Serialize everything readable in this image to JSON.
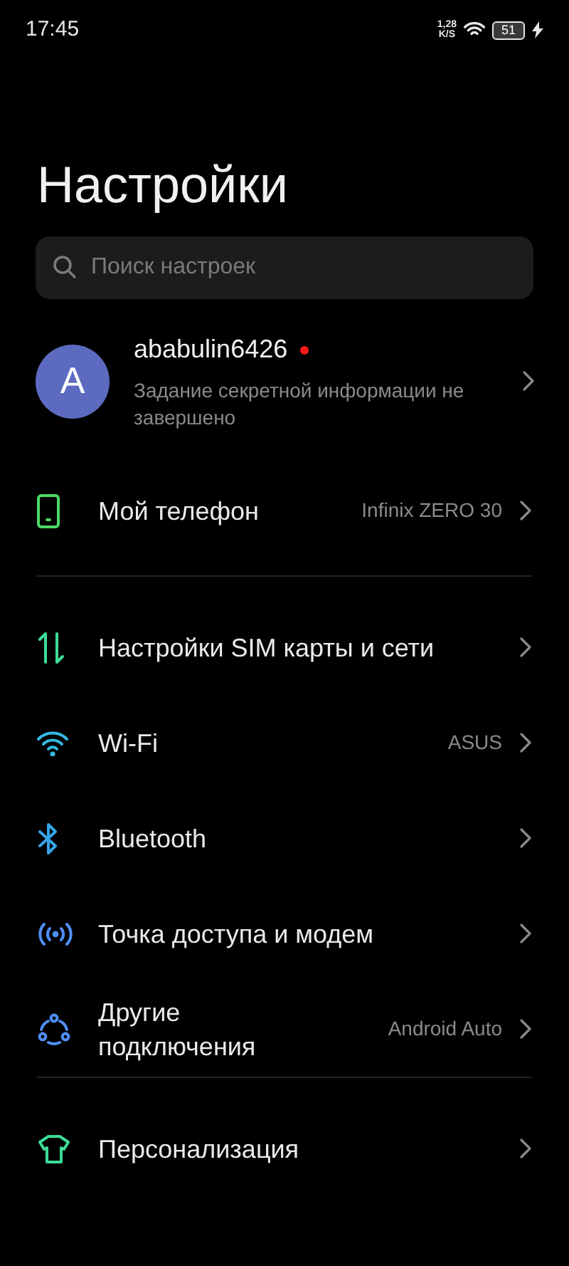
{
  "status_bar": {
    "time": "17:45",
    "speed_value": "1,28",
    "speed_unit": "K/S",
    "battery": "51",
    "charging": true
  },
  "title": "Настройки",
  "search": {
    "placeholder": "Поиск настроек"
  },
  "account": {
    "avatar_letter": "A",
    "name": "ababulin6426",
    "alert": true,
    "subtitle": "Задание секретной информации не завершено"
  },
  "sections": [
    [
      {
        "kind": "phone",
        "label": "Мой телефон",
        "value": "Infinix ZERO 30"
      }
    ],
    [
      {
        "kind": "sim",
        "label": "Настройки SIM карты и сети"
      },
      {
        "kind": "wifi",
        "label": "Wi-Fi",
        "value": "ASUS"
      },
      {
        "kind": "bluetooth",
        "label": "Bluetooth"
      },
      {
        "kind": "hotspot",
        "label": "Точка доступа и модем"
      },
      {
        "kind": "connections",
        "label": "Другие подключения",
        "value": "Android Auto"
      }
    ],
    [
      {
        "kind": "shirt",
        "label": "Персонализация"
      }
    ]
  ]
}
